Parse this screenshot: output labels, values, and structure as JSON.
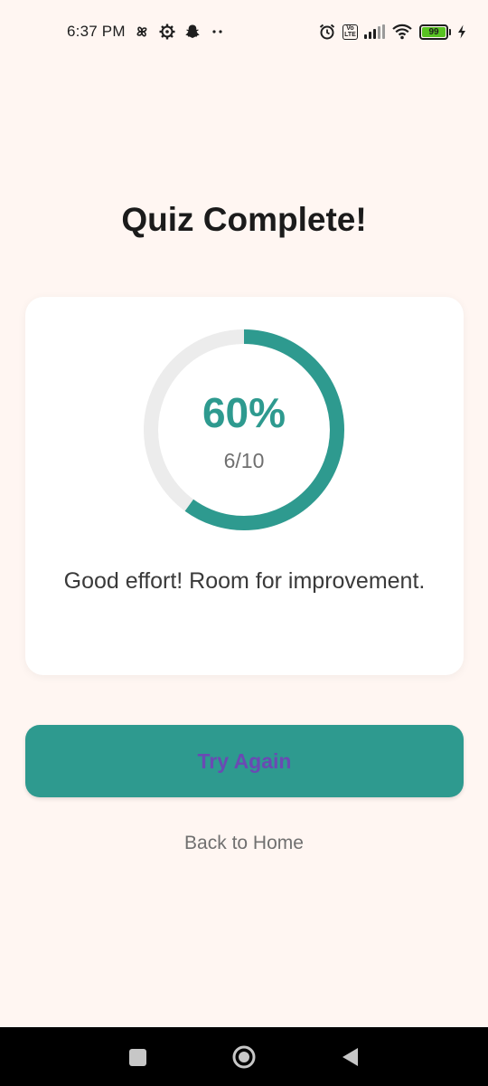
{
  "status_bar": {
    "time": "6:37 PM",
    "left_icons": [
      "pinwheel-icon",
      "gear-icon",
      "snapchat-icon",
      "more-dots-icon"
    ],
    "volte_label_top": "Vo",
    "volte_label_bottom": "LTE",
    "battery_level": "99",
    "battery_color": "#58c322"
  },
  "result": {
    "title": "Quiz Complete!",
    "percent_text": "60%",
    "score_text": "6/10",
    "progress_fraction": 0.6,
    "feedback": "Good effort! Room for improvement.",
    "accent_color": "#2e9a8f"
  },
  "actions": {
    "try_again_label": "Try Again",
    "back_home_label": "Back to Home"
  },
  "nav": {
    "icons": [
      "recent-apps-icon",
      "home-icon",
      "back-icon"
    ]
  }
}
